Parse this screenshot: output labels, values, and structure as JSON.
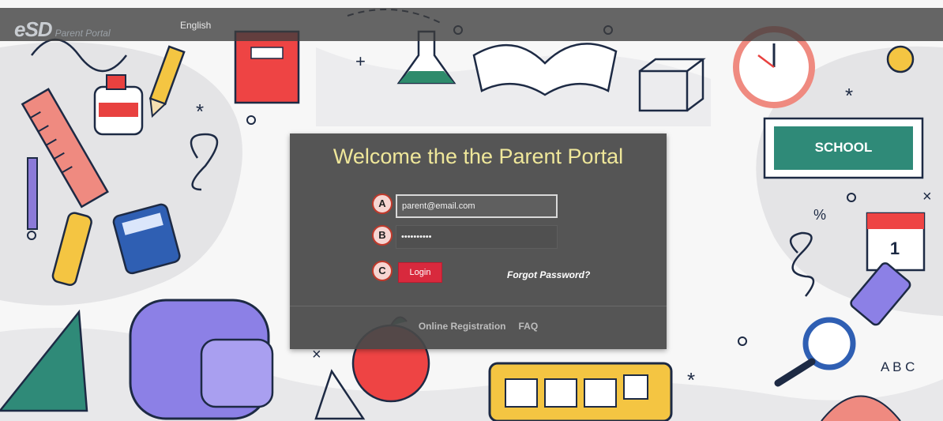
{
  "header": {
    "logo_mark": "eSD",
    "logo_sub": "Parent Portal",
    "language": "English"
  },
  "login": {
    "title": "Welcome the the Parent Portal",
    "email_value": "parent@email.com",
    "password_value": "••••••••••",
    "login_label": "Login",
    "forgot_label": "Forgot Password?"
  },
  "footer": {
    "links": [
      "Online Registration",
      "FAQ"
    ]
  },
  "annotations": [
    "A",
    "B",
    "C"
  ],
  "background": {
    "chalkboard_text": "SCHOOL",
    "calendar_day": "1",
    "letters": "A B C",
    "percent": "%"
  },
  "colors": {
    "panel_title": "#efe79a",
    "login_button": "#d8293d",
    "marker_border": "#c0392b"
  }
}
